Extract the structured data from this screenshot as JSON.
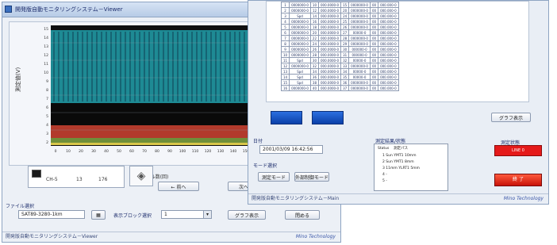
{
  "left_window": {
    "title": "開発版自動モニタリングシステム－Viewer",
    "chart": {
      "y_title": "測定値(V)",
      "x_title": "サイクル数(回)"
    },
    "legend": {
      "channel": "CH-5",
      "val1": "13",
      "val2": "176"
    },
    "prev_button": "← 前へ",
    "next_button": "次へ",
    "file_section_label": "ファイル選択",
    "file_value": "SAT89-3280-1km",
    "display_label": "表示ブロック選択",
    "display_value": "1",
    "graph_button": "グラフ表示",
    "close_button": "閉める",
    "footer": "開発版自動モニタリングシステム－Viewer",
    "logo": "Mino Technology"
  },
  "right_window": {
    "table_rows": [
      [
        "1",
        "0000000-0",
        "10",
        "000.0000-0",
        "15",
        "0000000-0",
        "00",
        "000.000-0"
      ],
      [
        "2",
        "0000000-0",
        "12",
        "000.0000-0",
        "20",
        "0000000-0",
        "00",
        "000.000-0"
      ],
      [
        "3",
        "Spd",
        "14",
        "000.0000-0",
        "24",
        "0000000-0",
        "00",
        "000.000-0"
      ],
      [
        "4",
        "0000000-0",
        "16",
        "000.0000-0",
        "25",
        "0000000-0",
        "00",
        "000.000-0"
      ],
      [
        "5",
        "0000000-0",
        "18",
        "000.0000-0",
        "26",
        "0000000-0",
        "00",
        "000.000-0"
      ],
      [
        "6",
        "0000000-0",
        "20",
        "000.0000-0",
        "27",
        "00000-0",
        "00",
        "000.000-0"
      ],
      [
        "7",
        "0000000-0",
        "22",
        "000.0000-0",
        "28",
        "0000000-0",
        "00",
        "000.000-0"
      ],
      [
        "8",
        "0000000-0",
        "24",
        "000.0000-0",
        "29",
        "0000000-0",
        "00",
        "000.000-0"
      ],
      [
        "9",
        "0000000-0",
        "26",
        "000.0000-0",
        "30",
        "000000-0",
        "00",
        "000.000-0"
      ],
      [
        "10",
        "0000000-0",
        "28",
        "000.0000-0",
        "31",
        "000000-0",
        "00",
        "000.000-0"
      ],
      [
        "11",
        "Spd",
        "30",
        "000.0000-0",
        "32",
        "00000-0",
        "00",
        "000.000-0"
      ],
      [
        "12",
        "0000000-0",
        "32",
        "000.0000-0",
        "33",
        "0000000-0",
        "00",
        "000.000-0"
      ],
      [
        "13",
        "Spd",
        "34",
        "000.0000-0",
        "34",
        "00000-0",
        "00",
        "000.000-0"
      ],
      [
        "14",
        "Spd",
        "36",
        "000.0000-0",
        "35",
        "00000-0",
        "00",
        "000.000-0"
      ],
      [
        "15",
        "Spd",
        "38",
        "000.0000-0",
        "36",
        "0000000-0",
        "00",
        "000.000-0"
      ],
      [
        "16",
        "0000000-0",
        "40",
        "000.0000-0",
        "37",
        "0000000-0",
        "00",
        "000.000-0"
      ]
    ],
    "graph_button": "グラフ表示",
    "date_label": "日付",
    "date_value": "2001/03/09 16:42:56",
    "mode_label": "モード選択",
    "mode_btn1": "測定モード",
    "mode_btn2": "外部制御モード",
    "info_title": "測定結果/状態",
    "info_header": [
      "Status",
      "測定パス"
    ],
    "info_rows": [
      [
        "1",
        "Sun YMT1 10mm"
      ],
      [
        "2",
        "Sun YMT1 8mm"
      ],
      [
        "3",
        "11mm YLRT1 5mm"
      ],
      [
        "4",
        "-"
      ],
      [
        "5",
        "-"
      ]
    ],
    "status_label": "測定状態",
    "status_value": "LINE 0",
    "stop_button": "終 了",
    "footer": "開発版自動モニタリングシステム－Main",
    "logo": "Mino Technology",
    "accent_blue": "#1f5fd4",
    "status_red": "#e51a1a"
  }
}
